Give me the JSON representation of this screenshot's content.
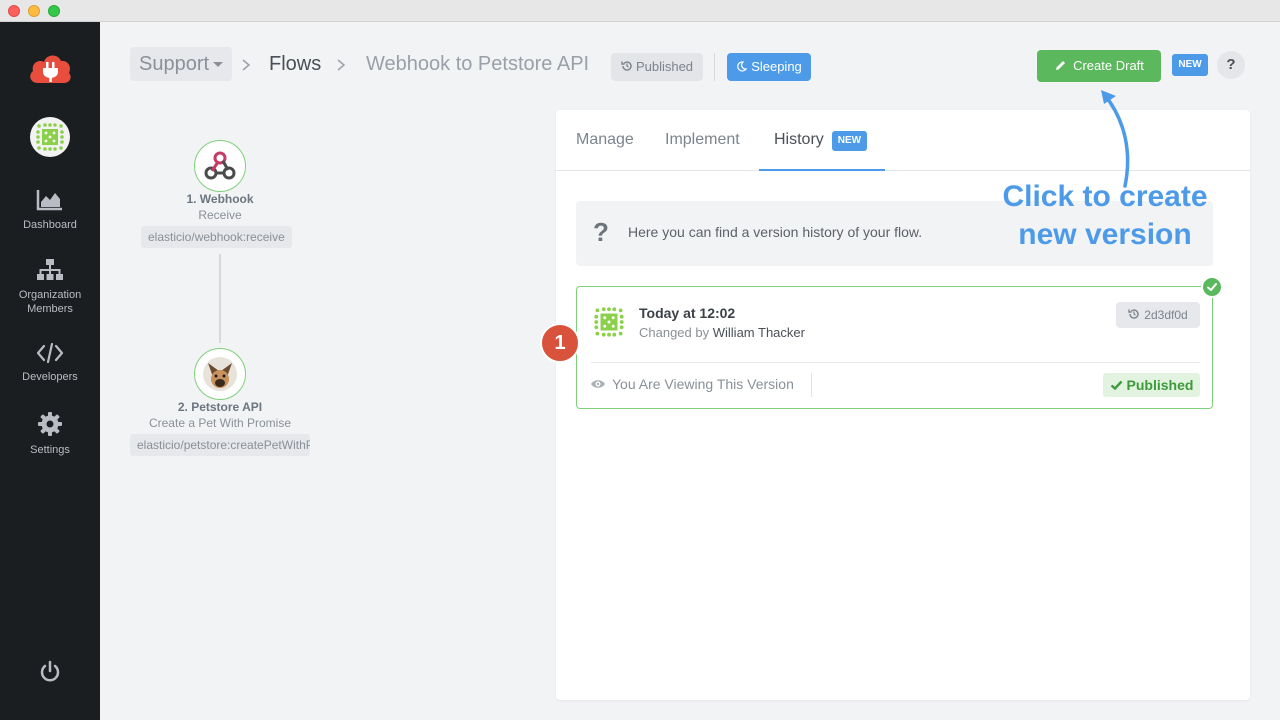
{
  "window": {
    "title": ""
  },
  "sidebar": {
    "items": [
      {
        "label": "Dashboard",
        "icon": "chart-area-icon"
      },
      {
        "label": "Organization Members",
        "icon": "sitemap-icon"
      },
      {
        "label": "Developers",
        "icon": "code-icon"
      },
      {
        "label": "Settings",
        "icon": "gear-icon"
      }
    ],
    "power_icon": "power-icon"
  },
  "header": {
    "workspace": "Support",
    "breadcrumb_flows": "Flows",
    "flow_name": "Webhook to Petstore API",
    "published_label": "Published",
    "sleeping_label": "Sleeping",
    "create_draft_label": "Create Draft",
    "new_badge": "NEW",
    "help_label": "?"
  },
  "flow": {
    "steps": [
      {
        "title": "1. Webhook",
        "subtitle": "Receive",
        "component": "elasticio/webhook:receive"
      },
      {
        "title": "2. Petstore API",
        "subtitle": "Create a Pet With Promise",
        "component": "elasticio/petstore:createPetWithPromise"
      }
    ]
  },
  "panel": {
    "tabs": [
      {
        "label": "Manage"
      },
      {
        "label": "Implement"
      },
      {
        "label": "History",
        "badge": "NEW",
        "active": true
      }
    ],
    "info_icon": "?",
    "info_text": "Here you can find a version history of your flow.",
    "version": {
      "time": "Today at 12:02",
      "changed_by_prefix": "Changed by",
      "author": "William Thacker",
      "hash": "2d3df0d",
      "viewing_label": "You Are Viewing This Version",
      "status_label": "Published"
    }
  },
  "annotations": {
    "step_number": "1",
    "callout_line1": "Click to create",
    "callout_line2": "new version"
  },
  "colors": {
    "sidebar_bg": "#1b1e21",
    "accent_blue": "#4d9be8",
    "success_green": "#5cb85c",
    "logo_red": "#e84d3d",
    "marker_red": "#d9533c"
  }
}
